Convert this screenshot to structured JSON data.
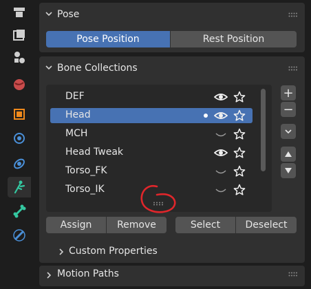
{
  "tabs": [
    {
      "icon": "tool-icon"
    },
    {
      "icon": "render-icon"
    },
    {
      "icon": "output-icon"
    },
    {
      "icon": "world-icon"
    },
    {
      "icon": "object-icon"
    },
    {
      "icon": "modifier-icon"
    },
    {
      "icon": "physics-icon"
    },
    {
      "icon": "armature-data-icon",
      "active": true
    },
    {
      "icon": "bone-icon"
    },
    {
      "icon": "bone-constraint-icon"
    }
  ],
  "pose": {
    "title": "Pose",
    "pose_position_label": "Pose Position",
    "rest_position_label": "Rest Position",
    "selected": "Pose Position"
  },
  "bone_collections": {
    "title": "Bone Collections",
    "items": [
      {
        "name": "DEF",
        "visible": true,
        "active_dot": false,
        "selected": false
      },
      {
        "name": "Head",
        "visible": true,
        "active_dot": true,
        "selected": true
      },
      {
        "name": "MCH",
        "visible": false,
        "active_dot": false,
        "selected": false
      },
      {
        "name": "Head Tweak",
        "visible": true,
        "active_dot": false,
        "selected": false
      },
      {
        "name": "Torso_FK",
        "visible": false,
        "active_dot": false,
        "selected": false
      },
      {
        "name": "Torso_IK",
        "visible": false,
        "active_dot": false,
        "selected": false
      }
    ],
    "assign_label": "Assign",
    "remove_label": "Remove",
    "select_label": "Select",
    "deselect_label": "Deselect",
    "add_symbol": "+",
    "remove_symbol": "−"
  },
  "custom_properties": {
    "title": "Custom Properties"
  },
  "motion_paths": {
    "title": "Motion Paths"
  },
  "colors": {
    "accent": "#4772b3",
    "panel": "#303030",
    "annotation": "#e0262b"
  }
}
